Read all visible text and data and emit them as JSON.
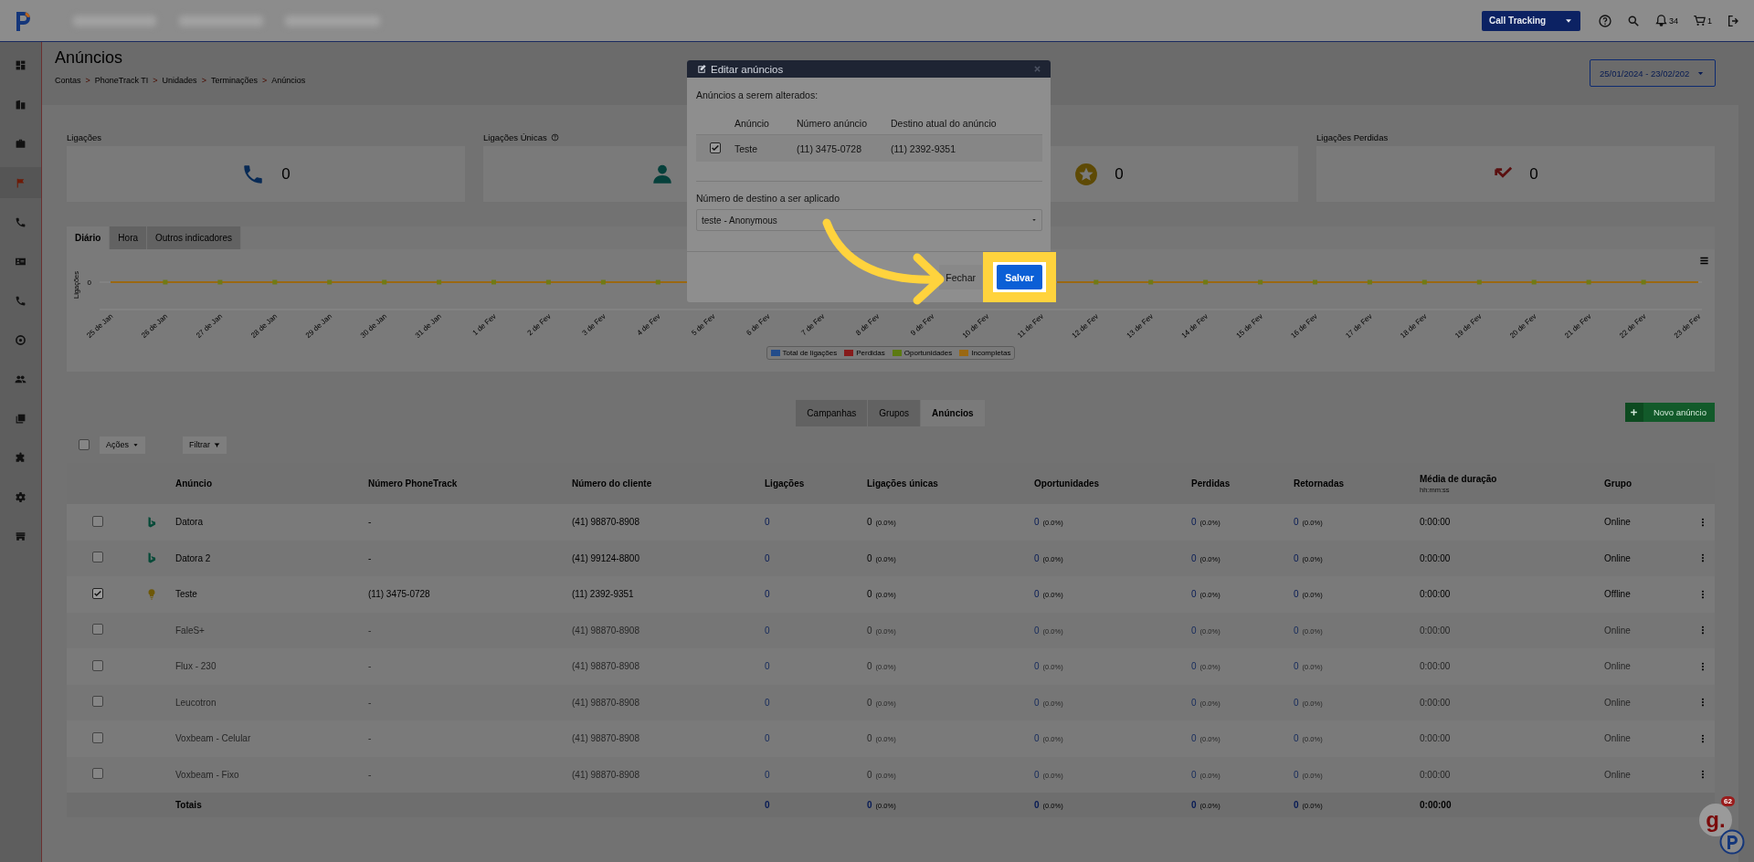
{
  "header": {
    "product_select": {
      "value": "Call Tracking"
    },
    "notifications": {
      "count": "34"
    },
    "cart": {
      "count": "1"
    }
  },
  "sidebar": {
    "items": [
      {
        "selected": false
      },
      {
        "selected": false
      },
      {
        "selected": false
      },
      {
        "selected": true
      },
      {
        "selected": false
      },
      {
        "selected": false
      },
      {
        "selected": false
      },
      {
        "selected": false
      },
      {
        "selected": false
      },
      {
        "selected": false
      },
      {
        "selected": false
      },
      {
        "selected": false
      },
      {
        "selected": false
      }
    ]
  },
  "page": {
    "title": "Anúncios",
    "breadcrumb": [
      "Contas",
      ">",
      "PhoneTrack TI",
      ">",
      "Unidades",
      ">",
      "Terminações",
      ">",
      "Anúncios"
    ],
    "date_range": {
      "value": "25/01/2024 - 23/02/202"
    }
  },
  "stat_cards": [
    {
      "label": "Ligações",
      "help": false,
      "value": "0"
    },
    {
      "label": "Ligações Únicas",
      "help": true
    },
    {
      "help": false,
      "value": "0"
    },
    {
      "label": "Ligações Perdidas",
      "help": false,
      "value": "0"
    }
  ],
  "chart_panel": {
    "tabs": [
      {
        "label": "Diário",
        "selected": true
      },
      {
        "label": "Hora",
        "selected": false
      },
      {
        "label": "Outros indicadores",
        "selected": false
      }
    ],
    "y_tick": "0",
    "y_axis_title": "Ligações",
    "x_labels": [
      "25 de Jan",
      "26 de Jan",
      "27 de Jan",
      "28 de Jan",
      "29 de Jan",
      "30 de Jan",
      "31 de Jan",
      "1 de Fev",
      "2 de Fev",
      "3 de Fev",
      "4 de Fev",
      "5 de Fev",
      "6 de Fev",
      "7 de Fev",
      "8 de Fev",
      "9 de Fev",
      "10 de Fev",
      "11 de Fev",
      "12 de Fev",
      "13 de Fev",
      "14 de Fev",
      "15 de Fev",
      "16 de Fev",
      "17 de Fev",
      "18 de Fev",
      "19 de Fev",
      "20 de Fev",
      "21 de Fev",
      "22 de Fev",
      "23 de Fev"
    ],
    "legend": [
      {
        "label": "Total de ligações",
        "color": "#234c8a"
      },
      {
        "label": "Perdidas",
        "color": "#861b1b"
      },
      {
        "label": "Oportunidades",
        "color": "#5c7a12"
      },
      {
        "label": "Incompletas",
        "color": "#9a6812"
      }
    ]
  },
  "section_tabs": [
    {
      "label": "Campanhas",
      "selected": false
    },
    {
      "label": "Grupos",
      "selected": false
    },
    {
      "label": "Anúncios",
      "selected": true
    }
  ],
  "new_button": {
    "label": "Novo anúncio"
  },
  "table": {
    "select_all": {
      "checked": false
    },
    "actions": {
      "label": "Ações"
    },
    "filter": {
      "label": "Filtrar"
    },
    "columns": [
      {
        "label": "Anúncio"
      },
      {
        "label": "Número PhoneTrack"
      },
      {
        "label": "Número do cliente"
      },
      {
        "label": "Ligações"
      },
      {
        "label": "Ligações únicas"
      },
      {
        "label": "Oportunidades"
      },
      {
        "label": "Perdidas"
      },
      {
        "label": "Retornadas"
      },
      {
        "label": "Média de duração",
        "sublabel": "hh:mm:ss"
      },
      {
        "label": "Grupo"
      }
    ],
    "rows": [
      {
        "checked": false,
        "inactive": false,
        "name": "Datora",
        "phonetrack": "-",
        "client": "(41) 98870-8908",
        "calls": "0",
        "unique": {
          "value": "0",
          "share": "(0.0%)"
        },
        "opportunities": {
          "value": "0",
          "share": "(0.0%)"
        },
        "missed": {
          "value": "0",
          "share": "(0.0%)"
        },
        "returned": {
          "value": "0",
          "share": "(0.0%)"
        },
        "duration": "0:00:00",
        "group": "Online"
      },
      {
        "checked": false,
        "inactive": false,
        "name": "Datora 2",
        "phonetrack": "-",
        "client": "(41) 99124-8800",
        "calls": "0",
        "unique": {
          "value": "0",
          "share": "(0.0%)"
        },
        "opportunities": {
          "value": "0",
          "share": "(0.0%)"
        },
        "missed": {
          "value": "0",
          "share": "(0.0%)"
        },
        "returned": {
          "value": "0",
          "share": "(0.0%)"
        },
        "duration": "0:00:00",
        "group": "Online"
      },
      {
        "checked": true,
        "inactive": false,
        "name": "Teste",
        "phonetrack": "(11) 3475-0728",
        "client": "(11) 2392-9351",
        "calls": "0",
        "unique": {
          "value": "0",
          "share": "(0.0%)"
        },
        "opportunities": {
          "value": "0",
          "share": "(0.0%)"
        },
        "missed": {
          "value": "0",
          "share": "(0.0%)"
        },
        "returned": {
          "value": "0",
          "share": "(0.0%)"
        },
        "duration": "0:00:00",
        "group": "Offline"
      },
      {
        "checked": false,
        "inactive": true,
        "name": "FaleS+",
        "phonetrack": "-",
        "client": "(41) 98870-8908",
        "calls": "0",
        "unique": {
          "value": "0",
          "share": "(0.0%)"
        },
        "opportunities": {
          "value": "0",
          "share": "(0.0%)"
        },
        "missed": {
          "value": "0",
          "share": "(0.0%)"
        },
        "returned": {
          "value": "0",
          "share": "(0.0%)"
        },
        "duration": "0:00:00",
        "group": "Online"
      },
      {
        "checked": false,
        "inactive": true,
        "name": "Flux - 230",
        "phonetrack": "-",
        "client": "(41) 98870-8908",
        "calls": "0",
        "unique": {
          "value": "0",
          "share": "(0.0%)"
        },
        "opportunities": {
          "value": "0",
          "share": "(0.0%)"
        },
        "missed": {
          "value": "0",
          "share": "(0.0%)"
        },
        "returned": {
          "value": "0",
          "share": "(0.0%)"
        },
        "duration": "0:00:00",
        "group": "Online"
      },
      {
        "checked": false,
        "inactive": true,
        "name": "Leucotron",
        "phonetrack": "-",
        "client": "(41) 98870-8908",
        "calls": "0",
        "unique": {
          "value": "0",
          "share": "(0.0%)"
        },
        "opportunities": {
          "value": "0",
          "share": "(0.0%)"
        },
        "missed": {
          "value": "0",
          "share": "(0.0%)"
        },
        "returned": {
          "value": "0",
          "share": "(0.0%)"
        },
        "duration": "0:00:00",
        "group": "Online"
      },
      {
        "checked": false,
        "inactive": true,
        "name": "Voxbeam - Celular",
        "phonetrack": "-",
        "client": "(41) 98870-8908",
        "calls": "0",
        "unique": {
          "value": "0",
          "share": "(0.0%)"
        },
        "opportunities": {
          "value": "0",
          "share": "(0.0%)"
        },
        "missed": {
          "value": "0",
          "share": "(0.0%)"
        },
        "returned": {
          "value": "0",
          "share": "(0.0%)"
        },
        "duration": "0:00:00",
        "group": "Online"
      },
      {
        "checked": false,
        "inactive": true,
        "name": "Voxbeam - Fixo",
        "phonetrack": "-",
        "client": "(41) 98870-8908",
        "calls": "0",
        "unique": {
          "value": "0",
          "share": "(0.0%)"
        },
        "opportunities": {
          "value": "0",
          "share": "(0.0%)"
        },
        "missed": {
          "value": "0",
          "share": "(0.0%)"
        },
        "returned": {
          "value": "0",
          "share": "(0.0%)"
        },
        "duration": "0:00:00",
        "group": "Online"
      }
    ],
    "totals": {
      "label": "Totais",
      "calls": "0",
      "unique": {
        "value": "0",
        "share": "(0.0%)"
      },
      "opportunities": {
        "value": "0",
        "share": "(0.0%)"
      },
      "missed": {
        "value": "0",
        "share": "(0.0%)"
      },
      "returned": {
        "value": "0",
        "share": "(0.0%)"
      },
      "duration": "0:00:00"
    }
  },
  "modal": {
    "title": "Editar anúncios",
    "section_label": "Anúncios a serem alterados:",
    "columns": [
      "Anúncio",
      "Número anúncio",
      "Destino atual do anúncio"
    ],
    "rows": [
      {
        "checked": true,
        "name": "Teste",
        "number": "(11) 3475-0728",
        "destination": "(11) 2392-9351"
      }
    ],
    "field": {
      "label": "Número de destino a ser aplicado",
      "value": "teste - Anonymous"
    },
    "buttons": [
      {
        "label": "Fechar",
        "kind": "secondary"
      },
      {
        "label": "Salvar",
        "kind": "primary",
        "highlighted": true
      }
    ]
  },
  "chat_widget": {
    "logo": "g.",
    "badge": "62"
  }
}
